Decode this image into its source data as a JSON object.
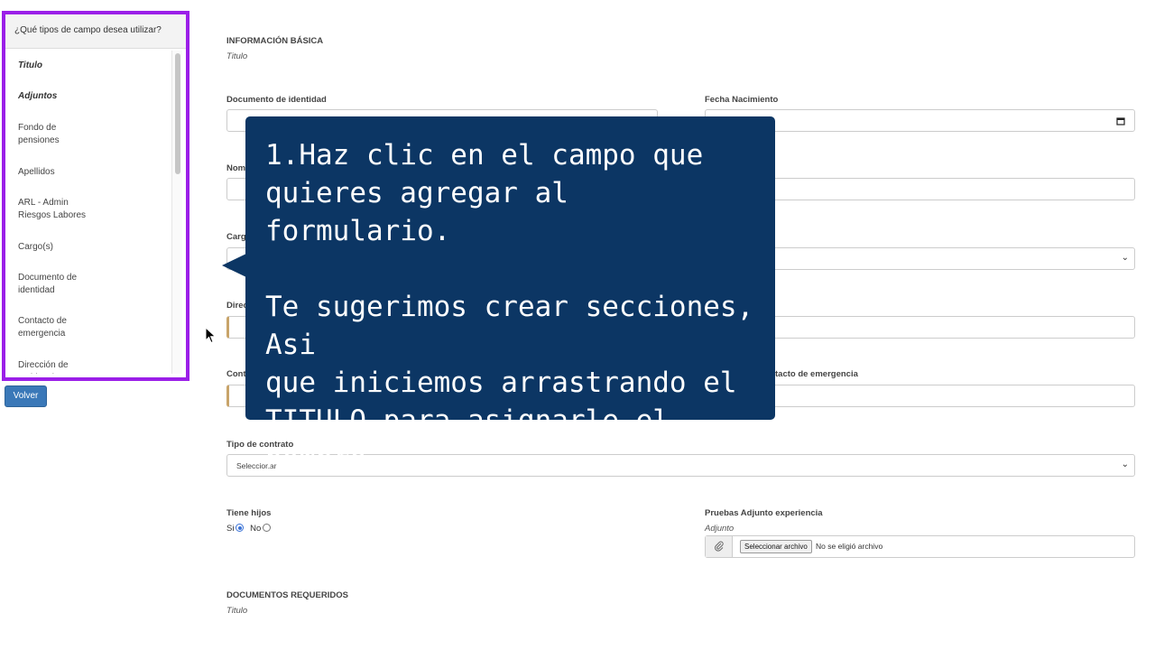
{
  "palette": {
    "header": "¿Qué tipos de campo desea utilizar?",
    "items": [
      {
        "label": "Titulo"
      },
      {
        "label": "Adjuntos"
      },
      {
        "label": "Fondo de pensiones"
      },
      {
        "label": "Apellidos"
      },
      {
        "label": "ARL - Admin Riesgos Labores"
      },
      {
        "label": "Cargo(s)"
      },
      {
        "label": "Documento de identidad"
      },
      {
        "label": "Contacto de emergencia"
      },
      {
        "label": "Dirección de residencia"
      }
    ]
  },
  "volver_label": "Volver",
  "form": {
    "section1_title": "INFORMACIÓN BÁSICA",
    "section1_sub": "Titulo",
    "doc_label": "Documento de identidad",
    "fecha_label": "Fecha Nacimiento",
    "nom_label_partial": "Nom",
    "cargo_label_partial": "Carg",
    "dir_label_partial": "Direc",
    "cont_label_partial": "Cont",
    "contacto_emergencia_partial": "tacto de emergencia",
    "tipo_contrato_label": "Tipo de contrato",
    "tipo_contrato_value": "Seleccionar",
    "hijos_label": "Tiene hijos",
    "hijos_options": [
      "Si",
      "No"
    ],
    "pruebas_label": "Pruebas Adjunto experiencia",
    "pruebas_sub": "Adjunto",
    "file_button": "Seleccionar archivo",
    "file_status": "No se eligió archivo",
    "section2_title": "DOCUMENTOS REQUERIDOS",
    "section2_sub": "Titulo"
  },
  "tooltip": {
    "para1": "1.Haz clic en el campo que\nquieres agregar al formulario.",
    "para2": "Te sugerimos crear secciones, Asi\nque iniciemos arrastrando el\nTITULO para asignarle el nombre\na la sección.",
    "bg_color": "#0c3664"
  },
  "accent_colors": {
    "palette_border": "#9b1fe8",
    "button": "#3a78b8"
  }
}
